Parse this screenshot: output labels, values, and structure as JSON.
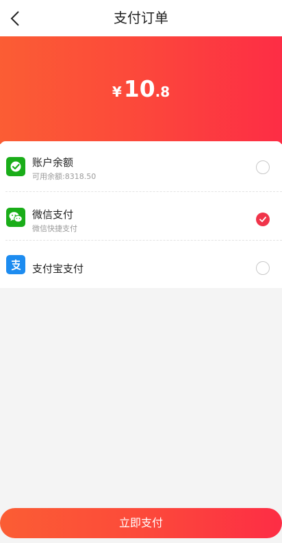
{
  "header": {
    "title": "支付订单",
    "back_icon": "chevron-left-icon"
  },
  "amount": {
    "currency": "¥",
    "integer": "10",
    "decimal": ".8"
  },
  "payment_methods": [
    {
      "title": "账户余额",
      "subtitle": "可用余额:8318.50",
      "icon": "wallet-icon",
      "icon_color": "#1aad19",
      "selected": false
    },
    {
      "title": "微信支付",
      "subtitle": "微信快捷支付",
      "icon": "wechat-icon",
      "icon_color": "#1aad19",
      "selected": true
    },
    {
      "title": "支付宝支付",
      "subtitle": "",
      "icon": "alipay-icon",
      "icon_color": "#1d8cf0",
      "selected": false
    }
  ],
  "submit_label": "立即支付",
  "colors": {
    "accent_start": "#fb5d34",
    "accent_end": "#fd2d45",
    "check": "#f0344a"
  }
}
